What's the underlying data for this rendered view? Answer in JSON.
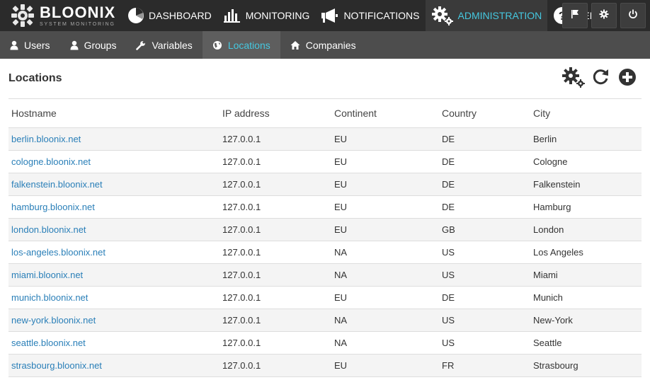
{
  "brand": {
    "name": "BLOONIX",
    "tagline": "SYSTEM MONITORING"
  },
  "topnav": [
    {
      "label": "DASHBOARD",
      "icon": "pie-chart-icon"
    },
    {
      "label": "MONITORING",
      "icon": "monitoring-icon"
    },
    {
      "label": "NOTIFICATIONS",
      "icon": "megaphone-icon"
    },
    {
      "label": "ADMINISTRATION",
      "icon": "gears-icon",
      "active": true
    },
    {
      "label": "HELP",
      "icon": "help-icon"
    }
  ],
  "topnav_right": [
    "flag-icon",
    "gear-icon",
    "power-icon"
  ],
  "subnav": [
    {
      "label": "Users",
      "icon": "user-icon"
    },
    {
      "label": "Groups",
      "icon": "user-icon"
    },
    {
      "label": "Variables",
      "icon": "wrench-icon"
    },
    {
      "label": "Locations",
      "icon": "globe-icon",
      "active": true
    },
    {
      "label": "Companies",
      "icon": "home-icon"
    }
  ],
  "page": {
    "title": "Locations"
  },
  "colors": {
    "accent": "#45c8e0",
    "link": "#2a7fb8",
    "topbar": "#2b2b2b",
    "subbar": "#4d4d4d"
  },
  "table": {
    "headers": [
      "Hostname",
      "IP address",
      "Continent",
      "Country",
      "City"
    ],
    "rows": [
      [
        "berlin.bloonix.net",
        "127.0.0.1",
        "EU",
        "DE",
        "Berlin"
      ],
      [
        "cologne.bloonix.net",
        "127.0.0.1",
        "EU",
        "DE",
        "Cologne"
      ],
      [
        "falkenstein.bloonix.net",
        "127.0.0.1",
        "EU",
        "DE",
        "Falkenstein"
      ],
      [
        "hamburg.bloonix.net",
        "127.0.0.1",
        "EU",
        "DE",
        "Hamburg"
      ],
      [
        "london.bloonix.net",
        "127.0.0.1",
        "EU",
        "GB",
        "London"
      ],
      [
        "los-angeles.bloonix.net",
        "127.0.0.1",
        "NA",
        "US",
        "Los Angeles"
      ],
      [
        "miami.bloonix.net",
        "127.0.0.1",
        "NA",
        "US",
        "Miami"
      ],
      [
        "munich.bloonix.net",
        "127.0.0.1",
        "EU",
        "DE",
        "Munich"
      ],
      [
        "new-york.bloonix.net",
        "127.0.0.1",
        "NA",
        "US",
        "New-York"
      ],
      [
        "seattle.bloonix.net",
        "127.0.0.1",
        "NA",
        "US",
        "Seattle"
      ],
      [
        "strasbourg.bloonix.net",
        "127.0.0.1",
        "EU",
        "FR",
        "Strasbourg"
      ]
    ]
  }
}
